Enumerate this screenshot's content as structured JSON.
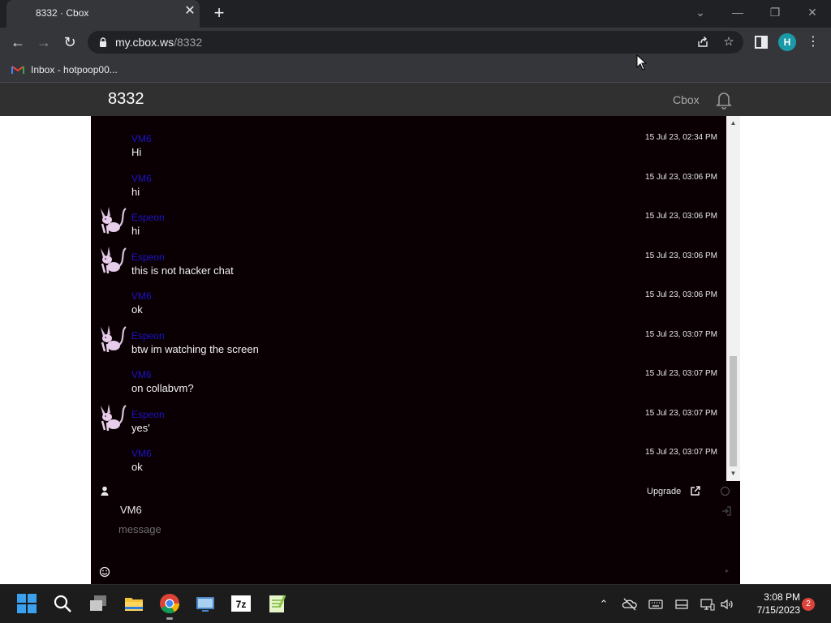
{
  "browser": {
    "tab_title": "8332 · Cbox",
    "tab_close": "✕",
    "new_tab": "+",
    "url_host": "my.cbox.ws",
    "url_path": "/8332",
    "profile_initial": "H",
    "bookmark_label": "Inbox - hotpoop00..."
  },
  "cbox": {
    "room_title": "8332",
    "brand_link": "Cbox",
    "upgrade_label": "Upgrade",
    "name_value": "VM6",
    "message_placeholder": "message",
    "name_color": "#1d11c9",
    "background_color": "#0a0003"
  },
  "messages": [
    {
      "name": "VM6",
      "text": "Hi",
      "time": "15 Jul 23, 02:34 PM",
      "avatar": false
    },
    {
      "name": "VM6",
      "text": "hi",
      "time": "15 Jul 23, 03:06 PM",
      "avatar": false
    },
    {
      "name": "Espeon",
      "text": "hi",
      "time": "15 Jul 23, 03:06 PM",
      "avatar": true
    },
    {
      "name": "Espeon",
      "text": "this is not hacker chat",
      "time": "15 Jul 23, 03:06 PM",
      "avatar": true
    },
    {
      "name": "VM6",
      "text": "ok",
      "time": "15 Jul 23, 03:06 PM",
      "avatar": false
    },
    {
      "name": "Espeon",
      "text": "btw im watching the screen",
      "time": "15 Jul 23, 03:07 PM",
      "avatar": true
    },
    {
      "name": "VM6",
      "text": "on collabvm?",
      "time": "15 Jul 23, 03:07 PM",
      "avatar": false
    },
    {
      "name": "Espeon",
      "text": "yes'",
      "time": "15 Jul 23, 03:07 PM",
      "avatar": true
    },
    {
      "name": "VM6",
      "text": "ok",
      "time": "15 Jul 23, 03:07 PM",
      "avatar": false
    }
  ],
  "taskbar": {
    "time": "3:08 PM",
    "date": "7/15/2023",
    "notification_count": "2",
    "apps": [
      "windows-start",
      "search",
      "task-view",
      "file-explorer",
      "chrome",
      "remote-desktop",
      "7zip",
      "notepad-plus"
    ]
  }
}
